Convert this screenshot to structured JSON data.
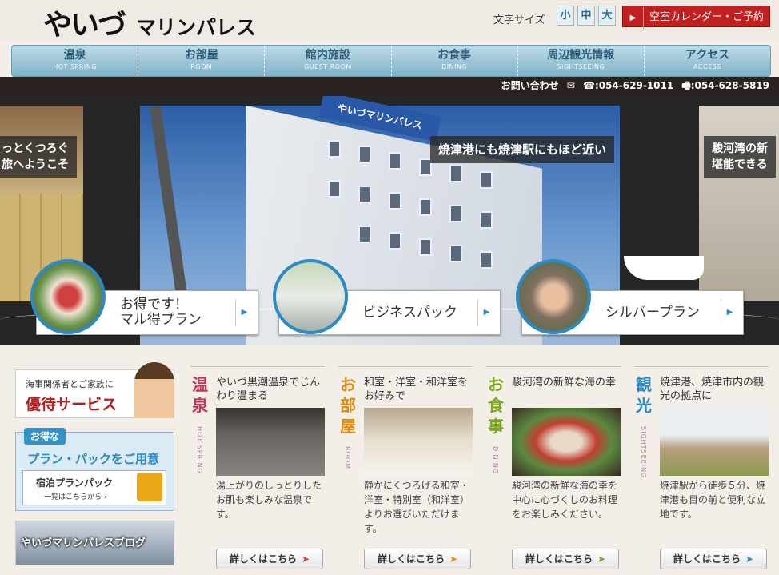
{
  "header": {
    "logo_part1": "やいづ",
    "logo_part2": "マリンパレス",
    "font_size_label": "文字サイズ",
    "font_size_options": [
      "小",
      "中",
      "大"
    ],
    "calendar_button": "空室カレンダー・ご予約",
    "calendar_arrow": "▶"
  },
  "nav": [
    {
      "jp": "温泉",
      "en": "HOT SPRING"
    },
    {
      "jp": "お部屋",
      "en": "ROOM"
    },
    {
      "jp": "館内施設",
      "en": "GUEST ROOM"
    },
    {
      "jp": "お食事",
      "en": "DINING"
    },
    {
      "jp": "周辺観光情報",
      "en": "SIGHTSEEING"
    },
    {
      "jp": "アクセス",
      "en": "ACCESS"
    }
  ],
  "contact": {
    "label": "お問い合わせ",
    "mail_icon": "✉",
    "tel": "☎:054-629-1011",
    "fax": "🖷:054-628-5819"
  },
  "hero": {
    "left_caption_1": "っとくつろぐ",
    "left_caption_2": "旅へようこそ",
    "main_caption": "焼津港にも焼津駅にもほど近い",
    "right_caption_1": "駿河湾の新",
    "right_caption_2": "堪能できる",
    "building_sign": "やいづマリンパレス",
    "plans": [
      {
        "line1": "お得です！",
        "line2": "マル得プラン"
      },
      {
        "line1": "ビジネスパック",
        "line2": ""
      },
      {
        "line1": "シルバープラン",
        "line2": ""
      }
    ]
  },
  "sidebar": {
    "banner1_small": "海事関係者とご家族に",
    "banner1_big": "優待サービス",
    "banner2_tag": "お得な",
    "banner2_heading": "プラン・パックをご用意",
    "banner2_box_title": "宿泊プランパック",
    "banner2_box_sub": "一覧はこちらから ›",
    "banner3_text": "やいづマリンパレスブログ"
  },
  "columns": [
    {
      "vt": "温泉",
      "ve": "HOT SPRING",
      "color": "#c0355a",
      "heading": "やいづ黒潮温泉でじんわり温まる",
      "desc": "湯上がりのしっとりしたお肌も楽しみな温泉です。",
      "more": "詳しくはこちら",
      "arrow_color": "#d04a3a"
    },
    {
      "vt": "お部屋",
      "ve": "ROOM",
      "color": "#e08a10",
      "heading": "和室・洋室・和洋室をお好みで",
      "desc": "静かにくつろげる和室・洋室・特別室（和洋室）よりお選びいただけます。",
      "more": "詳しくはこちら",
      "arrow_color": "#e08a10"
    },
    {
      "vt": "お食事",
      "ve": "DINING",
      "color": "#7aa81a",
      "heading": "駿河湾の新鮮な海の幸",
      "desc": "駿河湾の新鮮な海の幸を中心に心づくしのお料理をお楽しみください。",
      "more": "詳しくはこちら",
      "arrow_color": "#7aa81a"
    },
    {
      "vt": "観光",
      "ve": "SIGHTSEEING",
      "color": "#2c8ac5",
      "heading": "焼津港、焼津市内の観光の拠点に",
      "desc": "焼津駅から徒歩５分、焼津港も目の前と便利な立地です。",
      "more": "詳しくはこちら",
      "arrow_color": "#2c8ac5"
    }
  ]
}
